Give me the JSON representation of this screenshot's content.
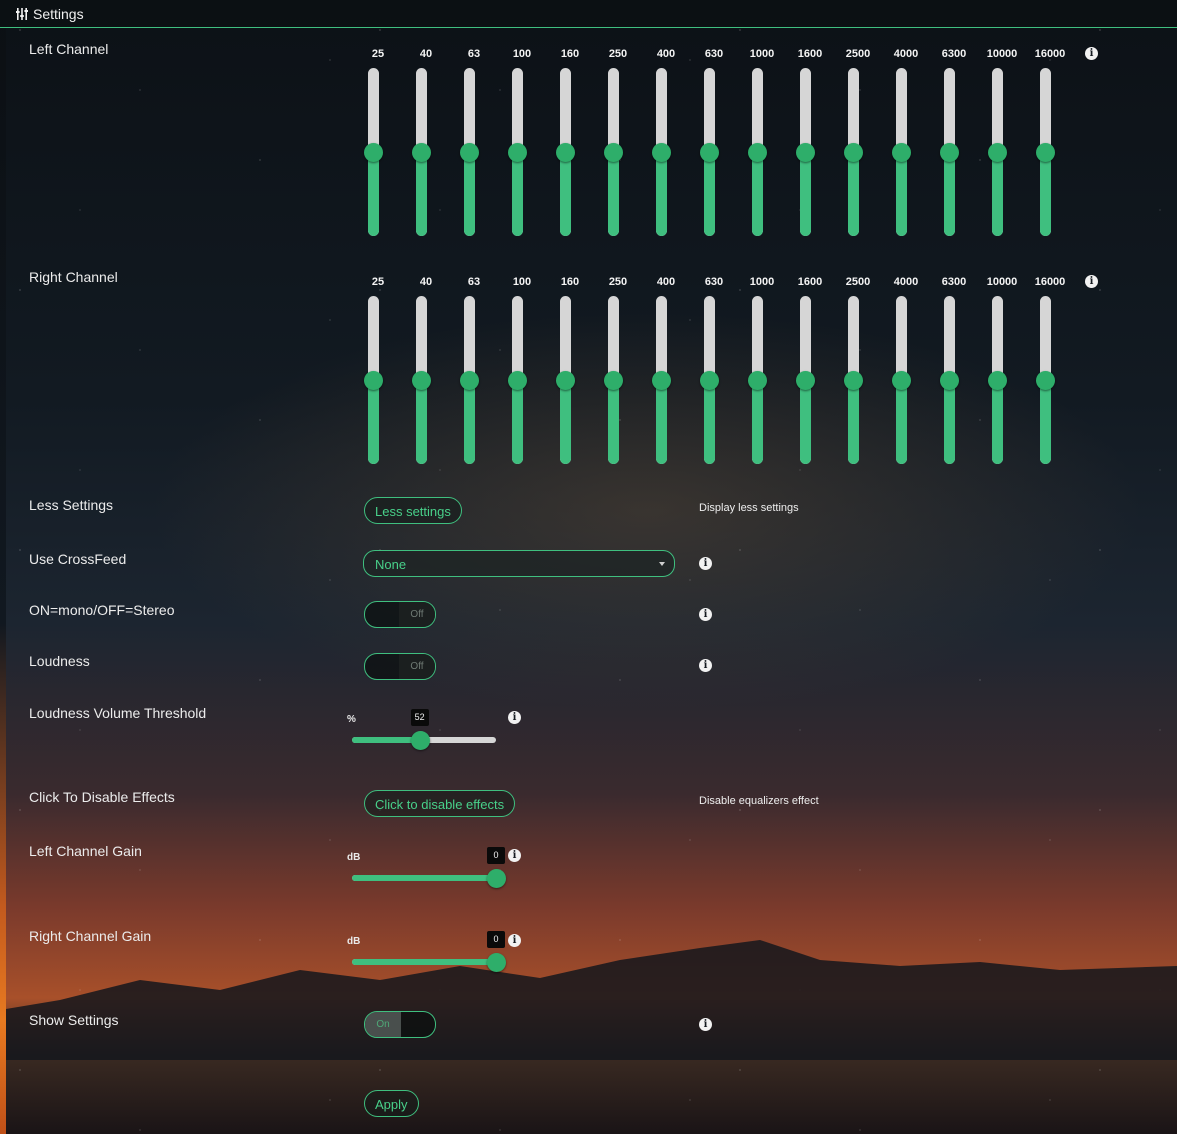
{
  "window": {
    "title": "Settings",
    "icon": "sliders-icon"
  },
  "frequencies": [
    "25",
    "40",
    "63",
    "100",
    "160",
    "250",
    "400",
    "630",
    "1000",
    "1600",
    "2500",
    "4000",
    "6300",
    "10000",
    "16000"
  ],
  "left_channel": {
    "label": "Left Channel",
    "band_level": 0.5
  },
  "right_channel": {
    "label": "Right Channel",
    "band_level": 0.5
  },
  "less_settings": {
    "label": "Less Settings",
    "button": "Less settings",
    "help": "Display less settings"
  },
  "crossfeed": {
    "label": "Use CrossFeed",
    "value": "None"
  },
  "mono": {
    "label": "ON=mono/OFF=Stereo",
    "state": "Off"
  },
  "loudness": {
    "label": "Loudness",
    "state": "Off"
  },
  "loudness_threshold": {
    "label": "Loudness Volume Threshold",
    "unit": "%",
    "value": "52",
    "fraction": 0.47
  },
  "disable_effects": {
    "label": "Click To Disable Effects",
    "button": "Click to disable effects",
    "help": "Disable equalizers effect"
  },
  "left_gain": {
    "label": "Left Channel Gain",
    "unit": "dB",
    "value": "0",
    "fraction": 1.0
  },
  "right_gain": {
    "label": "Right Channel Gain",
    "unit": "dB",
    "value": "0",
    "fraction": 1.0
  },
  "show_settings": {
    "label": "Show Settings",
    "state": "On"
  },
  "apply": {
    "label": "Apply"
  },
  "colors": {
    "accent": "#3fbf7f",
    "knob": "#2eae6a",
    "track": "#d6d6d6"
  }
}
